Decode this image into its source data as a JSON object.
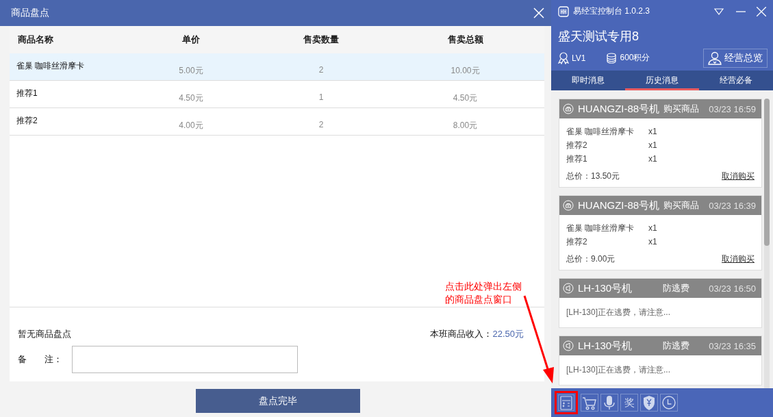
{
  "stock_window": {
    "title": "商品盘点",
    "columns": [
      "商品名称",
      "单价",
      "售卖数量",
      "售卖总额"
    ],
    "rows": [
      {
        "name": "雀巢 咖啡丝滑摩卡",
        "price": "5.00元",
        "quantity": "2",
        "total": "10.00元",
        "selected": true
      },
      {
        "name": "推荐1",
        "price": "4.50元",
        "quantity": "1",
        "total": "4.50元",
        "selected": false
      },
      {
        "name": "推荐2",
        "price": "4.00元",
        "quantity": "2",
        "total": "8.00元",
        "selected": false
      }
    ],
    "status": "暂无商品盘点",
    "income_label": "本班商品收入：",
    "income_value": "22.50元",
    "remark_label": "备　　注：",
    "finish_button": "盘点完毕"
  },
  "console": {
    "title": "易经宝控制台 1.0.2.3",
    "user": "盛天测试专用8",
    "level": "LV1",
    "points": "600积分",
    "overview_button": "经营总览",
    "tabs": [
      {
        "label": "即时消息",
        "selected": false
      },
      {
        "label": "历史消息",
        "selected": true
      },
      {
        "label": "经营必备",
        "selected": false
      }
    ],
    "messages": [
      {
        "kind": "purchase",
        "machine": "HUANGZI-88号机",
        "type": "购买商品",
        "time": "03/23 16:59",
        "items": [
          {
            "name": "雀巢 咖啡丝滑摩卡",
            "qty": "x1"
          },
          {
            "name": "推荐2",
            "qty": "x1"
          },
          {
            "name": "推荐1",
            "qty": "x1"
          }
        ],
        "total": "总价：13.50元",
        "action": "取消购买"
      },
      {
        "kind": "purchase",
        "machine": "HUANGZI-88号机",
        "type": "购买商品",
        "time": "03/23 16:39",
        "items": [
          {
            "name": "雀巢 咖啡丝滑摩卡",
            "qty": "x1"
          },
          {
            "name": "推荐2",
            "qty": "x1"
          }
        ],
        "total": "总价：9.00元",
        "action": "取消购买"
      },
      {
        "kind": "alert",
        "machine": "LH-130号机",
        "type": "防逃费",
        "time": "03/23 16:50",
        "text": "[LH-130]正在逃费，请注意..."
      },
      {
        "kind": "alert",
        "machine": "LH-130号机",
        "type": "防逃费",
        "time": "03/23 16:35",
        "text": "[LH-130]正在逃费，请注意..."
      }
    ],
    "tools": [
      {
        "kind": "calculator",
        "highlighted": true
      },
      {
        "kind": "cart",
        "highlighted": false
      },
      {
        "kind": "microphone",
        "highlighted": false
      },
      {
        "kind": "text",
        "label": "奖",
        "highlighted": false
      },
      {
        "kind": "shield",
        "highlighted": false
      },
      {
        "kind": "clock",
        "highlighted": false
      }
    ]
  },
  "annotation": {
    "lines": [
      "点击此处弹出左侧",
      "的商品盘点窗口"
    ]
  }
}
